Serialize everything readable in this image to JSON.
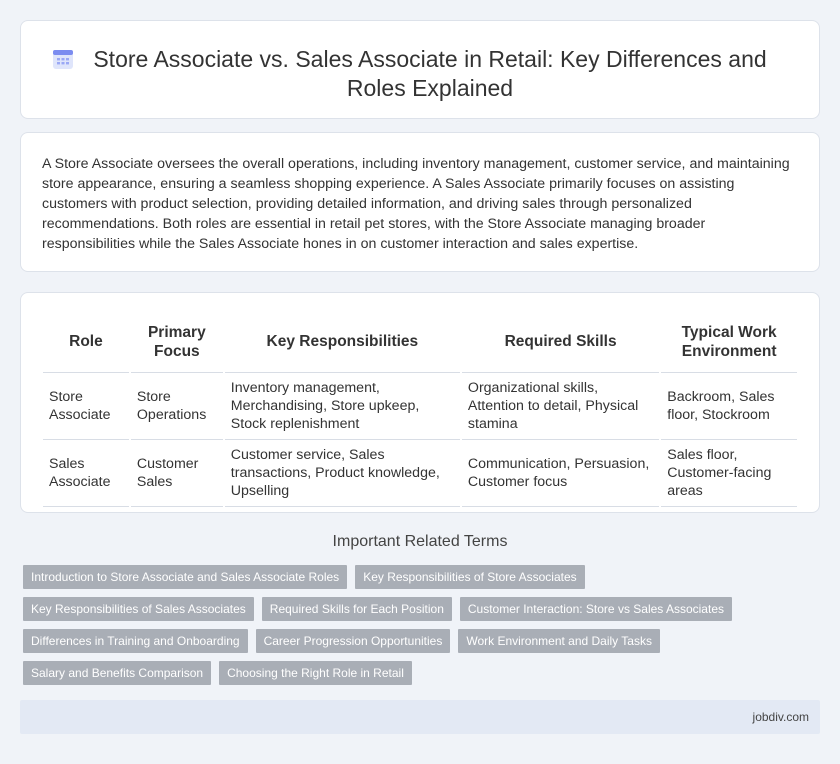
{
  "header": {
    "title": "Store Associate vs. Sales Associate in Retail: Key Differences and Roles Explained",
    "icon": "calendar-icon"
  },
  "intro": {
    "text": "A Store Associate oversees the overall operations, including inventory management, customer service, and maintaining store appearance, ensuring a seamless shopping experience. A Sales Associate primarily focuses on assisting customers with product selection, providing detailed information, and driving sales through personalized recommendations. Both roles are essential in retail pet stores, with the Store Associate managing broader responsibilities while the Sales Associate hones in on customer interaction and sales expertise."
  },
  "table": {
    "headers": [
      "Role",
      "Primary Focus",
      "Key Responsibilities",
      "Required Skills",
      "Typical Work Environment"
    ],
    "rows": [
      [
        "Store Associate",
        "Store Operations",
        "Inventory management, Merchandising, Store upkeep, Stock replenishment",
        "Organizational skills, Attention to detail, Physical stamina",
        "Backroom, Sales floor, Stockroom"
      ],
      [
        "Sales Associate",
        "Customer Sales",
        "Customer service, Sales transactions, Product knowledge, Upselling",
        "Communication, Persuasion, Customer focus",
        "Sales floor, Customer-facing areas"
      ]
    ]
  },
  "related": {
    "title": "Important Related Terms",
    "rows": [
      [
        "Introduction to Store Associate and Sales Associate Roles",
        "Key Responsibilities of Store Associates"
      ],
      [
        "Key Responsibilities of Sales Associates",
        "Required Skills for Each Position",
        "Customer Interaction: Store vs Sales Associates"
      ],
      [
        "Differences in Training and Onboarding",
        "Career Progression Opportunities",
        "Work Environment and Daily Tasks"
      ],
      [
        "Salary and Benefits Comparison",
        "Choosing the Right Role in Retail"
      ]
    ]
  },
  "footer": {
    "site": "jobdiv.com"
  },
  "colors": {
    "background": "#f0f3f8",
    "tag": "#a9aeb6",
    "footer": "#e3e9f4",
    "icon_accent": "#7b8cf0"
  }
}
